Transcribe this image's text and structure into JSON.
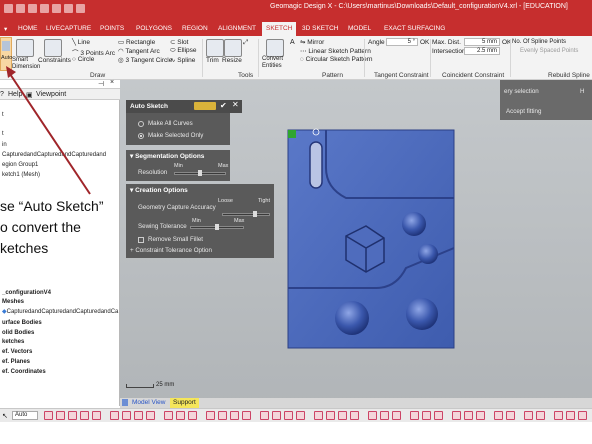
{
  "window": {
    "title": "Geomagic Design X - C:\\Users\\martinus\\Downloads\\Default_configurationV4.xrl - [EDUCATION]"
  },
  "menu_tabs": [
    {
      "label": "HOME"
    },
    {
      "label": "LIVECAPTURE"
    },
    {
      "label": "POINTS"
    },
    {
      "label": "POLYGONS"
    },
    {
      "label": "REGION"
    },
    {
      "label": "ALIGNMENT"
    },
    {
      "label": "SKETCH"
    },
    {
      "label": "3D SKETCH"
    },
    {
      "label": "MODEL"
    },
    {
      "label": "EXACT SURFACING"
    }
  ],
  "ribbon": {
    "auto_sketch": "Auto Sketch",
    "smart_dimension": "Smart Dimension",
    "constraints": "Constraints",
    "line": "Line",
    "points_arc": "3 Points Arc",
    "circle": "Circle",
    "rectangle": "Rectangle",
    "tangent_arc": "Tangent Arc",
    "tangent_circle": "3 Tangent Circle",
    "slot": "Slot",
    "ellipse": "Ellipse",
    "spline": "Spline",
    "trim": "Trim",
    "resize": "Resize",
    "convert_entities": "Convert Entities",
    "mirror": "Mirror",
    "linear_sketch_pattern": "Linear Sketch Pattern",
    "circular_sketch_pattern": "Circular Sketch Pattern",
    "angle_label": "Angle",
    "angle_value": "5 °",
    "ok_label": "OK",
    "max_dist_label": "Max. Dist.",
    "max_dist_value": "5 mm",
    "ok2_label": "OK",
    "intersection_label": "Intersection",
    "intersection_value": "2.5 mm",
    "spline_points_label": "No. Of Spline Points",
    "evenly_spaced": "Evenly Spaced Points",
    "groups": {
      "draw": "Draw",
      "tools": "Tools",
      "pattern": "Pattern",
      "tangent_constraint": "Tangent Constraint",
      "coincident_constraint": "Coincident Constraint",
      "rebuild_spline": "Rebuild Spline"
    }
  },
  "left_pane": {
    "tab_help": "Help",
    "tab_viewpoint": "Viewpoint",
    "tree_top": [
      {
        "label": "t"
      },
      {
        "label": "t"
      },
      {
        "label": "in"
      },
      {
        "label": "CapturedandCapturedandCapturedand"
      },
      {
        "label": "egion Group1"
      },
      {
        "label": "ketch1 (Mesh)"
      }
    ],
    "tree_bottom": [
      {
        "label": "_configurationV4"
      },
      {
        "label": "Meshes"
      },
      {
        "label": "CapturedandCapturedandCapturedandCa"
      },
      {
        "label": "urface Bodies"
      },
      {
        "label": "olid Bodies"
      },
      {
        "label": "ketches"
      },
      {
        "label": "ef. Vectors"
      },
      {
        "label": "ef. Planes"
      },
      {
        "label": "ef. Coordinates"
      }
    ]
  },
  "annotation": {
    "line1": "se “Auto Sketch”",
    "line2": "o convert the",
    "line3": "ketches"
  },
  "auto_sketch_panel": {
    "title": "Auto Sketch",
    "make_all_curves": "Make All Curves",
    "make_selected_only": "Make Selected Only",
    "segmentation_title": "Segmentation Options",
    "resolution_label": "Resolution",
    "res_min": "Min",
    "res_max": "Max",
    "creation_title": "Creation Options",
    "geometry_capture_label": "Geometry Capture Accuracy",
    "loose": "Loose",
    "tight": "Tight",
    "sewing_label": "Sewing Tolerance",
    "sew_min": "Min",
    "sew_max": "Max",
    "remove_small_fillet": "Remove Small Fillet",
    "constraint_tolerance": "Constraint Tolerance Option",
    "resolution_level": 0.5,
    "geometry_level": 0.7,
    "sewing_level": 0.5
  },
  "right_panel": {
    "any_selection": "ery selection",
    "accept_fitting": "Accept fitting",
    "h_label": "H"
  },
  "viewport": {
    "scale": "25 mm"
  },
  "bottom_tabs": [
    {
      "label": "Model View"
    },
    {
      "label": "Support"
    }
  ],
  "toolbar": {
    "auto_select": "Auto"
  },
  "colors": {
    "brand_red": "#c62e2e",
    "panel_gray": "#5a5a5a",
    "part_blue": "#4766b8",
    "annotation_arrow": "#a0252a"
  }
}
